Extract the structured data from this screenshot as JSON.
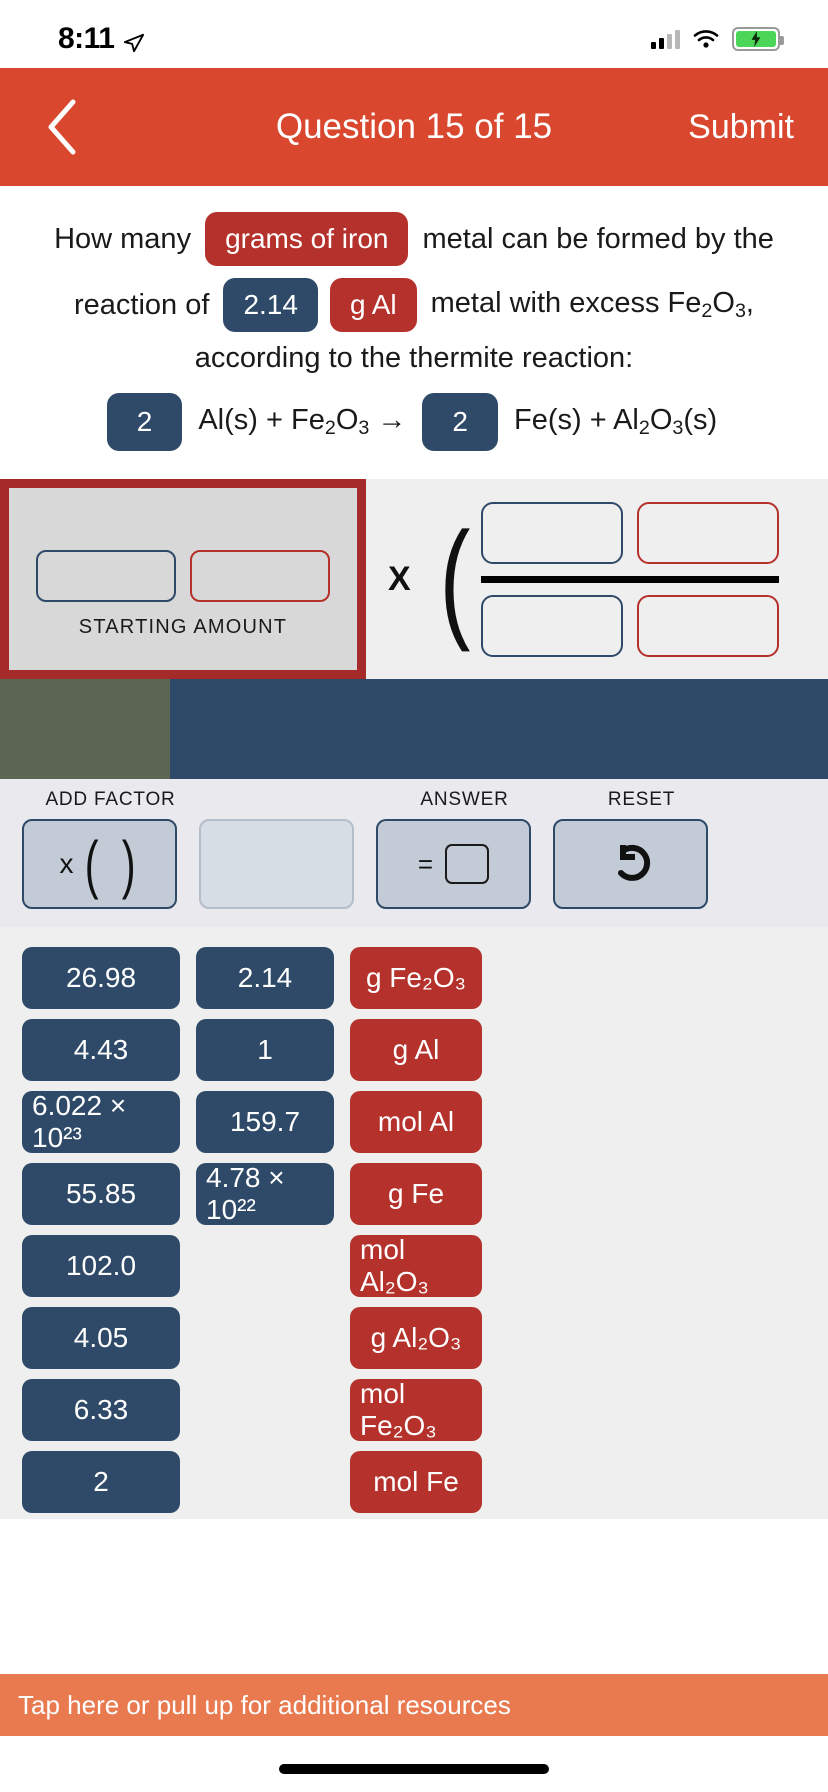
{
  "status_bar": {
    "time": "8:11",
    "location_icon": "location-arrow-icon",
    "signal_icon": "cellular-signal-icon",
    "wifi_icon": "wifi-icon",
    "battery_icon": "battery-charging-icon"
  },
  "nav": {
    "back_icon": "chevron-left-icon",
    "title": "Question 15 of 15",
    "submit_label": "Submit"
  },
  "question": {
    "line1_a": "How many",
    "chip_grams_of_iron": "grams of iron",
    "line1_b": "metal can be formed by the",
    "line2_a": "reaction of",
    "chip_amount": "2.14",
    "chip_unit": "g Al",
    "line2_b": "metal with excess Fe",
    "line2_sub1": "2",
    "line2_b2": "O",
    "line2_sub2": "3",
    "line2_b3": ",",
    "line3": "according to the thermite reaction:",
    "equation": {
      "coeff1": "2",
      "reactants_a": "Al(s) + Fe",
      "reactants_sub1": "2",
      "reactants_b": "O",
      "reactants_sub2": "3",
      "arrow": "→",
      "coeff2": "2",
      "products_a": "Fe(s) + Al",
      "products_sub1": "2",
      "products_b": "O",
      "products_sub2": "3",
      "products_c": "(s)"
    }
  },
  "work_area": {
    "starting_amount_label": "STARTING AMOUNT",
    "starting_value_slot": "",
    "starting_unit_slot": "",
    "multiply_symbol": "X",
    "numerator_value_slot": "",
    "numerator_unit_slot": "",
    "denominator_value_slot": "",
    "denominator_unit_slot": ""
  },
  "toolbar": {
    "add_factor_label": "ADD FACTOR",
    "answer_label": "ANSWER",
    "reset_label": "RESET",
    "add_factor_glyph": "x (  )",
    "answer_eq": "=",
    "reset_glyph": "↺"
  },
  "tiles": {
    "numbers_col1": [
      "26.98",
      "4.43",
      "6.022 × 10²³",
      "55.85",
      "102.0",
      "4.05",
      "6.33",
      "2"
    ],
    "numbers_col2": [
      "2.14",
      "1",
      "159.7",
      "4.78 × 10²²"
    ],
    "units_col3": [
      "g Fe₂O₃",
      "g Al",
      "mol Al",
      "g Fe",
      "mol Al₂O₃",
      "g Al₂O₃",
      "mol Fe₂O₃",
      "mol Fe"
    ]
  },
  "footer": {
    "text": "Tap here or pull up for additional resources"
  },
  "colors": {
    "nav_red": "#d9472e",
    "chip_red": "#b5312c",
    "chip_blue": "#2e4a68",
    "start_border": "#a52a2a",
    "band_olive": "#5d6652",
    "band_navy": "#2e4a68",
    "footer_orange": "#e9794f"
  }
}
